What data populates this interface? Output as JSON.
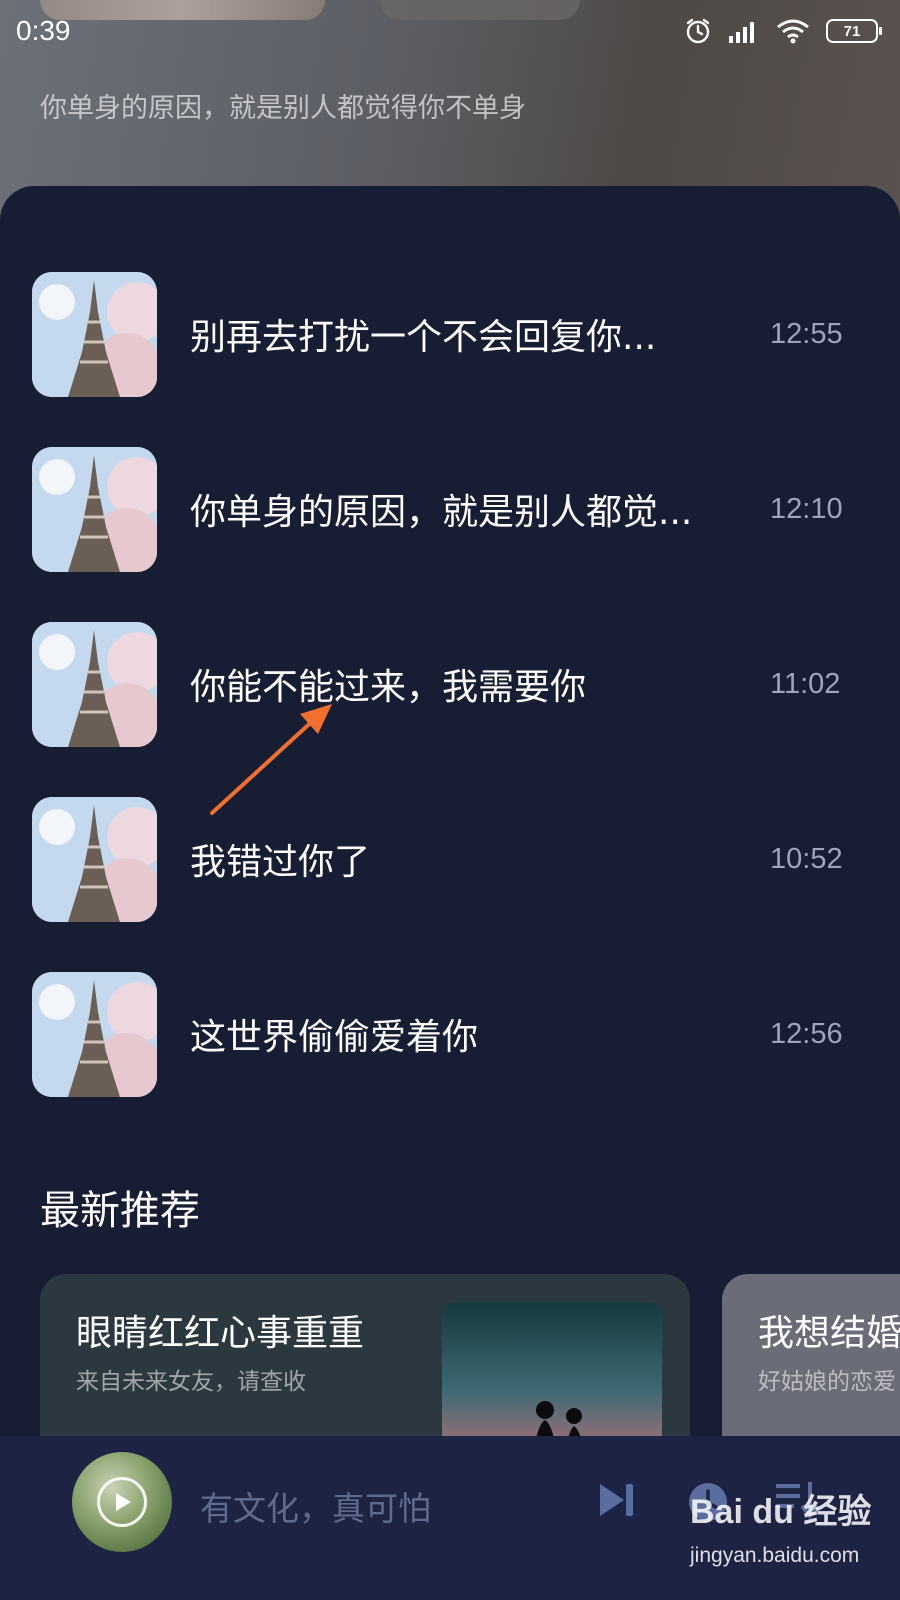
{
  "status_bar": {
    "time": "0:39",
    "battery": "71"
  },
  "header": {
    "subtitle": "你单身的原因，就是别人都觉得你不单身"
  },
  "songs": [
    {
      "title": "别再去打扰一个不会回复你...",
      "time": "12:55"
    },
    {
      "title": "你单身的原因，就是别人都觉...",
      "time": "12:10"
    },
    {
      "title": "你能不能过来，我需要你",
      "time": "11:02"
    },
    {
      "title": "我错过你了",
      "time": "10:52"
    },
    {
      "title": "这世界偷偷爱着你",
      "time": "12:56"
    }
  ],
  "recommend": {
    "section_title": "最新推荐",
    "cards": [
      {
        "title": "眼睛红红心事重重",
        "subtitle": "来自未来女友，请查收"
      },
      {
        "title": "我想结婚",
        "subtitle": "好姑娘的恋爱"
      }
    ]
  },
  "player": {
    "title": "有文化，真可怕"
  },
  "watermark": {
    "logo": "Bai du 经验",
    "url": "jingyan.baidu.com"
  },
  "colors": {
    "panel_bg": "#171d33",
    "player_bg": "#1d2443",
    "accent_arrow": "#f2702e",
    "time_text": "#9ea5b8"
  }
}
